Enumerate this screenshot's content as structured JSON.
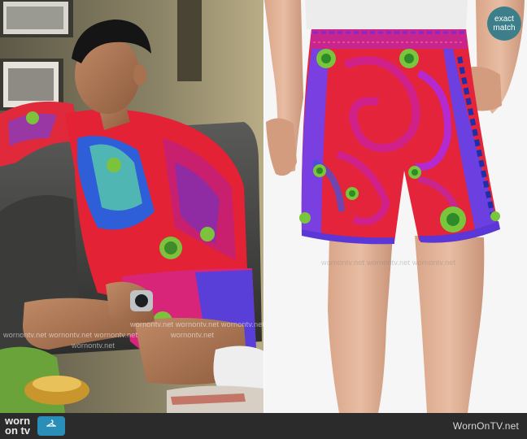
{
  "footer": {
    "brand_line1": "worn",
    "brand_line2": "on tv",
    "site": "WornOnTV.net",
    "bg": "#2b2b2b",
    "accent": "#2a8fb8"
  },
  "badge": {
    "line1": "exact",
    "line2": "match",
    "color": "#3c7e8a"
  },
  "watermark": {
    "text": "wornontv.net",
    "row": "wornontv.net wornontv.net wornontv.net"
  },
  "left_photo": {
    "subject": "man-in-printed-sweatshirt-and-shorts-on-sofa"
  },
  "right_photo": {
    "subject": "printed-silk-shorts-product-shot"
  }
}
